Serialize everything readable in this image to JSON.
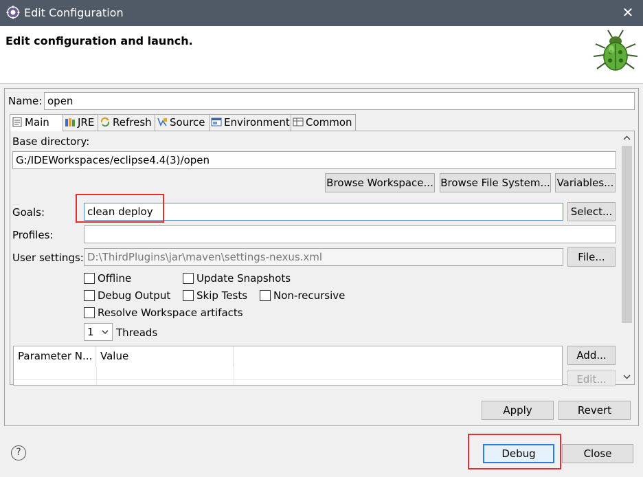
{
  "window": {
    "title": "Edit Configuration",
    "close_glyph": "✕",
    "icon": "gear-icon"
  },
  "header": {
    "title": "Edit configuration and launch.",
    "logo": "bug-icon"
  },
  "name_row": {
    "label": "Name:",
    "value": "open"
  },
  "tabs": [
    {
      "label": "Main",
      "icon": "document-icon",
      "active": true
    },
    {
      "label": "JRE",
      "icon": "library-icon"
    },
    {
      "label": "Refresh",
      "icon": "refresh-icon"
    },
    {
      "label": "Source",
      "icon": "source-icon"
    },
    {
      "label": "Environment",
      "icon": "environment-icon"
    },
    {
      "label": "Common",
      "icon": "common-icon"
    }
  ],
  "main": {
    "base_directory_label": "Base directory:",
    "base_directory_value": "G:/IDEWorkspaces/eclipse4.4(3)/open",
    "browse_workspace": "Browse Workspace...",
    "browse_file_system": "Browse File System...",
    "variables": "Variables...",
    "goals_label": "Goals:",
    "goals_value": "clean deploy",
    "select": "Select...",
    "profiles_label": "Profiles:",
    "profiles_value": "",
    "user_settings_label": "User settings:",
    "user_settings_value": "D:\\ThirdPlugins\\jar\\maven\\settings-nexus.xml",
    "file": "File...",
    "checkboxes": {
      "offline": "Offline",
      "update_snapshots": "Update Snapshots",
      "debug_output": "Debug Output",
      "skip_tests": "Skip Tests",
      "non_recursive": "Non-recursive",
      "resolve_workspace": "Resolve Workspace artifacts"
    },
    "threads_value": "1",
    "threads_label": "Threads",
    "param_table": {
      "columns": [
        "Parameter N...",
        "Value"
      ]
    },
    "add": "Add...",
    "edit": "Edit..."
  },
  "footer": {
    "apply": "Apply",
    "revert": "Revert",
    "debug": "Debug",
    "close": "Close",
    "help_glyph": "?"
  },
  "colors": {
    "title_bar": "#505a66",
    "highlight": "#e03030",
    "focus": "#4a8ad7"
  }
}
